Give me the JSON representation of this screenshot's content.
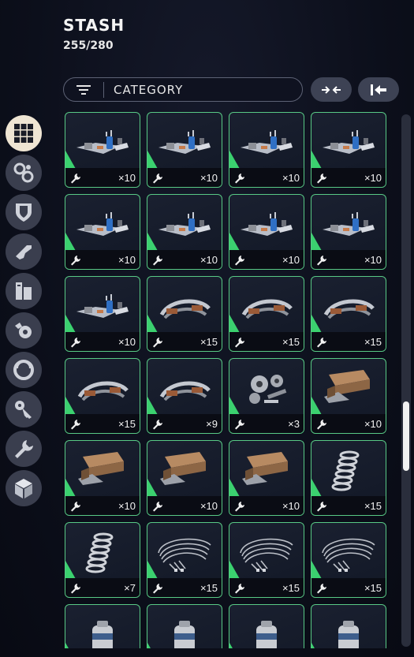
{
  "stash": {
    "title": "STASH",
    "capacity": "255/280"
  },
  "filter": {
    "label": "CATEGORY",
    "icon": "filter-lines-icon"
  },
  "actions": {
    "collapse_icon": "merge-arrows-icon",
    "transfer_icon": "arrow-to-bar-icon"
  },
  "categories": [
    {
      "name": "all-items",
      "icon": "grid-icon",
      "active": true
    },
    {
      "name": "attachments",
      "icon": "chain-links-icon",
      "active": false
    },
    {
      "name": "armor",
      "icon": "shield-icon",
      "active": false
    },
    {
      "name": "weapons",
      "icon": "pistol-icon",
      "active": false
    },
    {
      "name": "consumables",
      "icon": "books-icon",
      "active": false
    },
    {
      "name": "parts",
      "icon": "gear-wrench-icon",
      "active": false
    },
    {
      "name": "gear",
      "icon": "ring-icon",
      "active": false
    },
    {
      "name": "keys",
      "icon": "key-icon",
      "active": false
    },
    {
      "name": "crafting",
      "icon": "wrench-icon",
      "active": false
    },
    {
      "name": "misc",
      "icon": "cube-icon",
      "active": false
    }
  ],
  "items": [
    {
      "kind": "machine-parts",
      "qty": "×10"
    },
    {
      "kind": "machine-parts",
      "qty": "×10"
    },
    {
      "kind": "machine-parts",
      "qty": "×10"
    },
    {
      "kind": "machine-parts",
      "qty": "×10"
    },
    {
      "kind": "machine-parts",
      "qty": "×10"
    },
    {
      "kind": "machine-parts",
      "qty": "×10"
    },
    {
      "kind": "machine-parts",
      "qty": "×10"
    },
    {
      "kind": "machine-parts",
      "qty": "×10"
    },
    {
      "kind": "machine-parts",
      "qty": "×10"
    },
    {
      "kind": "pipe-assembly",
      "qty": "×15"
    },
    {
      "kind": "pipe-assembly",
      "qty": "×15"
    },
    {
      "kind": "pipe-assembly",
      "qty": "×15"
    },
    {
      "kind": "pipe-assembly",
      "qty": "×15"
    },
    {
      "kind": "pipe-assembly",
      "qty": "×9"
    },
    {
      "kind": "gears",
      "qty": "×3"
    },
    {
      "kind": "box-bracket",
      "qty": "×10"
    },
    {
      "kind": "box-bracket",
      "qty": "×10"
    },
    {
      "kind": "box-bracket",
      "qty": "×10"
    },
    {
      "kind": "box-bracket",
      "qty": "×10"
    },
    {
      "kind": "spring",
      "qty": "×15"
    },
    {
      "kind": "spring",
      "qty": "×7"
    },
    {
      "kind": "wires",
      "qty": "×15"
    },
    {
      "kind": "wires",
      "qty": "×15"
    },
    {
      "kind": "wires",
      "qty": "×15"
    },
    {
      "kind": "canister",
      "qty": ""
    },
    {
      "kind": "canister",
      "qty": ""
    },
    {
      "kind": "canister",
      "qty": ""
    },
    {
      "kind": "canister",
      "qty": ""
    }
  ],
  "scroll": {
    "position": 0.62,
    "visible_fraction": 0.13
  },
  "colors": {
    "slot_border": "#58c985",
    "rarity": "#3bd16f",
    "active_category": "#efe5d3",
    "button": "#3d4254"
  }
}
